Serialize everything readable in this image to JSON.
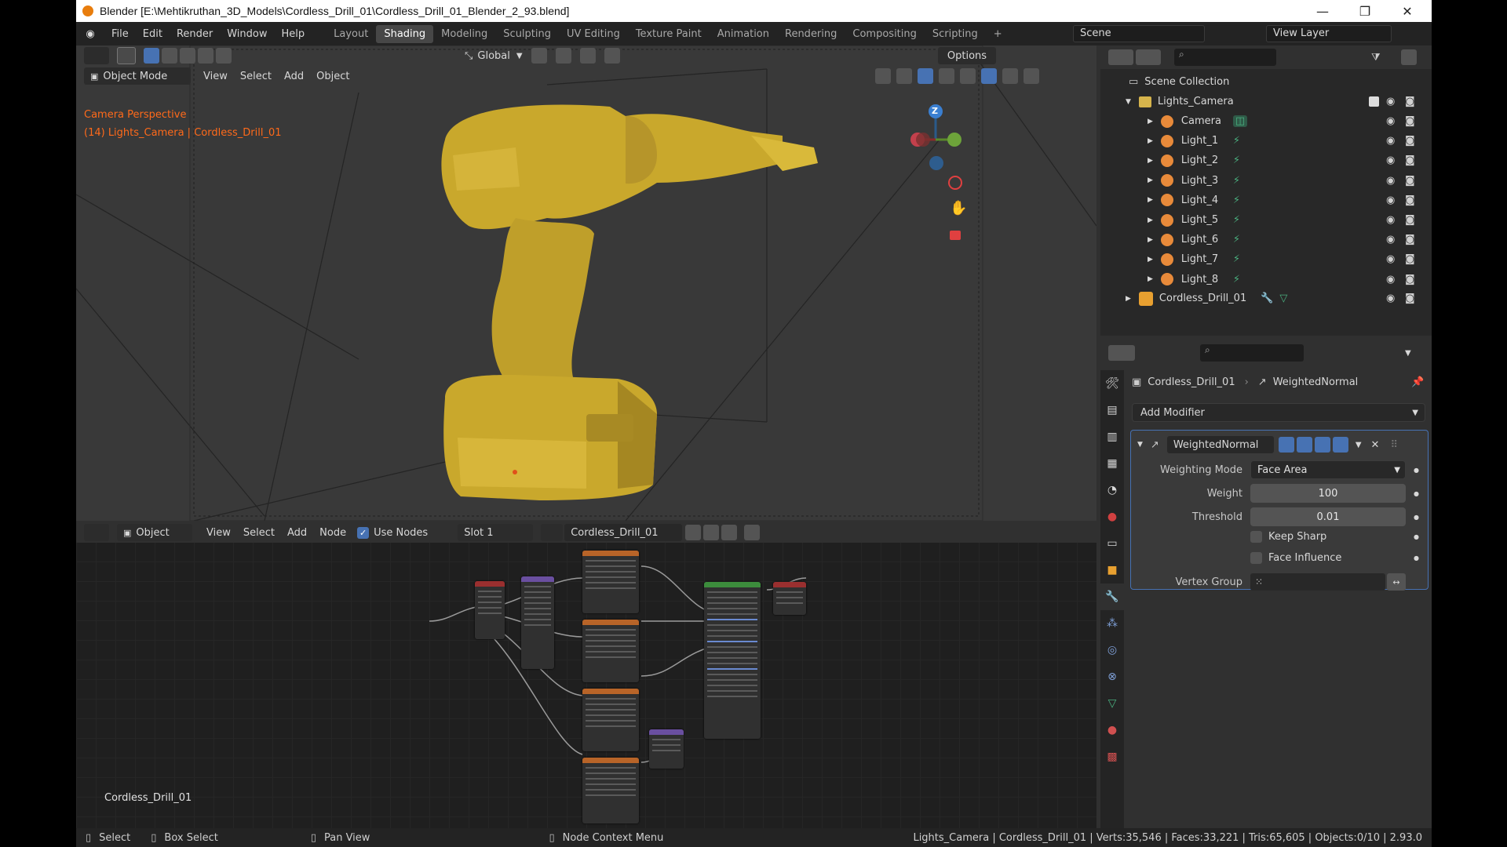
{
  "window": {
    "title": "Blender [E:\\Mehtikruthan_3D_Models\\Cordless_Drill_01\\Cordless_Drill_01_Blender_2_93.blend]",
    "controls": {
      "minimize": "—",
      "maximize": "❐",
      "close": "✕"
    }
  },
  "menu": [
    "File",
    "Edit",
    "Render",
    "Window",
    "Help"
  ],
  "workspaces": [
    "Layout",
    "Shading",
    "Modeling",
    "Sculpting",
    "UV Editing",
    "Texture Paint",
    "Animation",
    "Rendering",
    "Compositing",
    "Scripting"
  ],
  "active_workspace": "Shading",
  "add_workspace": "+",
  "scene": {
    "name": "Scene",
    "view_layer": "View Layer"
  },
  "viewport": {
    "transform_orientation": "Global",
    "options_label": "Options",
    "mode": "Object Mode",
    "menus": [
      "View",
      "Select",
      "Add",
      "Object"
    ],
    "overlay_line1": "Camera Perspective",
    "overlay_line2": "(14) Lights_Camera | Cordless_Drill_01",
    "gizmo_z": "Z",
    "drill_color": "#c9a82c"
  },
  "node_editor": {
    "type": "Object",
    "menus": [
      "View",
      "Select",
      "Add",
      "Node"
    ],
    "use_nodes_label": "Use Nodes",
    "slot": "Slot 1",
    "material": "Cordless_Drill_01",
    "footer_label": "Cordless_Drill_01"
  },
  "outliner": {
    "scene_collection": "Scene Collection",
    "collection": "Lights_Camera",
    "children": [
      "Camera",
      "Light_1",
      "Light_2",
      "Light_3",
      "Light_4",
      "Light_5",
      "Light_6",
      "Light_7",
      "Light_8"
    ],
    "object": "Cordless_Drill_01"
  },
  "properties": {
    "breadcrumb_object": "Cordless_Drill_01",
    "breadcrumb_modifier": "WeightedNormal",
    "add_modifier": "Add Modifier",
    "modifier_name": "WeightedNormal",
    "fields": {
      "weighting_mode_label": "Weighting Mode",
      "weighting_mode_value": "Face Area",
      "weight_label": "Weight",
      "weight_value": "100",
      "threshold_label": "Threshold",
      "threshold_value": "0.01",
      "keep_sharp_label": "Keep Sharp",
      "face_influence_label": "Face Influence",
      "vertex_group_label": "Vertex Group"
    }
  },
  "statusbar": {
    "select": "Select",
    "box_select": "Box Select",
    "pan_view": "Pan View",
    "node_context_menu": "Node Context Menu",
    "stats": "Lights_Camera | Cordless_Drill_01 | Verts:35,546 | Faces:33,221 | Tris:65,605 | Objects:0/10 | 2.93.0"
  },
  "colors": {
    "accent": "#4772b3",
    "overlay_text": "#ff6a1a",
    "node_header_orange": "#b86428",
    "node_header_purple": "#6a4fa0",
    "node_header_green": "#3c8c3c",
    "node_header_red": "#9a2f2f"
  }
}
